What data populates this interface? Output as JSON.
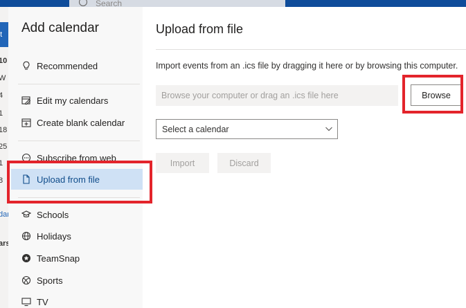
{
  "background": {
    "search_placeholder": "Search",
    "new_button_label": "nt",
    "left_ticks": [
      "10",
      "W",
      "4",
      "1",
      "18",
      "25",
      "1",
      "8",
      "dar",
      "ars"
    ]
  },
  "dialog": {
    "sidebar": {
      "title": "Add calendar",
      "items": [
        {
          "label": "Recommended",
          "icon": "lightbulb-icon"
        },
        {
          "label": "Edit my calendars",
          "icon": "edit-calendar-icon"
        },
        {
          "label": "Create blank calendar",
          "icon": "calendar-add-icon"
        },
        {
          "label": "Subscribe from web",
          "icon": "link-icon"
        },
        {
          "label": "Upload from file",
          "icon": "file-icon",
          "selected": true
        },
        {
          "label": "Schools",
          "icon": "graduation-cap-icon"
        },
        {
          "label": "Holidays",
          "icon": "globe-icon"
        },
        {
          "label": "TeamSnap",
          "icon": "teamsnap-icon"
        },
        {
          "label": "Sports",
          "icon": "sports-ball-icon"
        },
        {
          "label": "TV",
          "icon": "tv-icon"
        }
      ]
    },
    "main": {
      "title": "Upload from file",
      "description": "Import events from an .ics file by dragging it here or by browsing this computer.",
      "file_input_placeholder": "Browse your computer or drag an .ics file here",
      "browse_label": "Browse",
      "select_placeholder": "Select a calendar",
      "import_label": "Import",
      "discard_label": "Discard"
    }
  },
  "colors": {
    "highlight": "#e3242b",
    "selected_bg": "#cfe1f5",
    "selected_text": "#0f4c8a"
  }
}
